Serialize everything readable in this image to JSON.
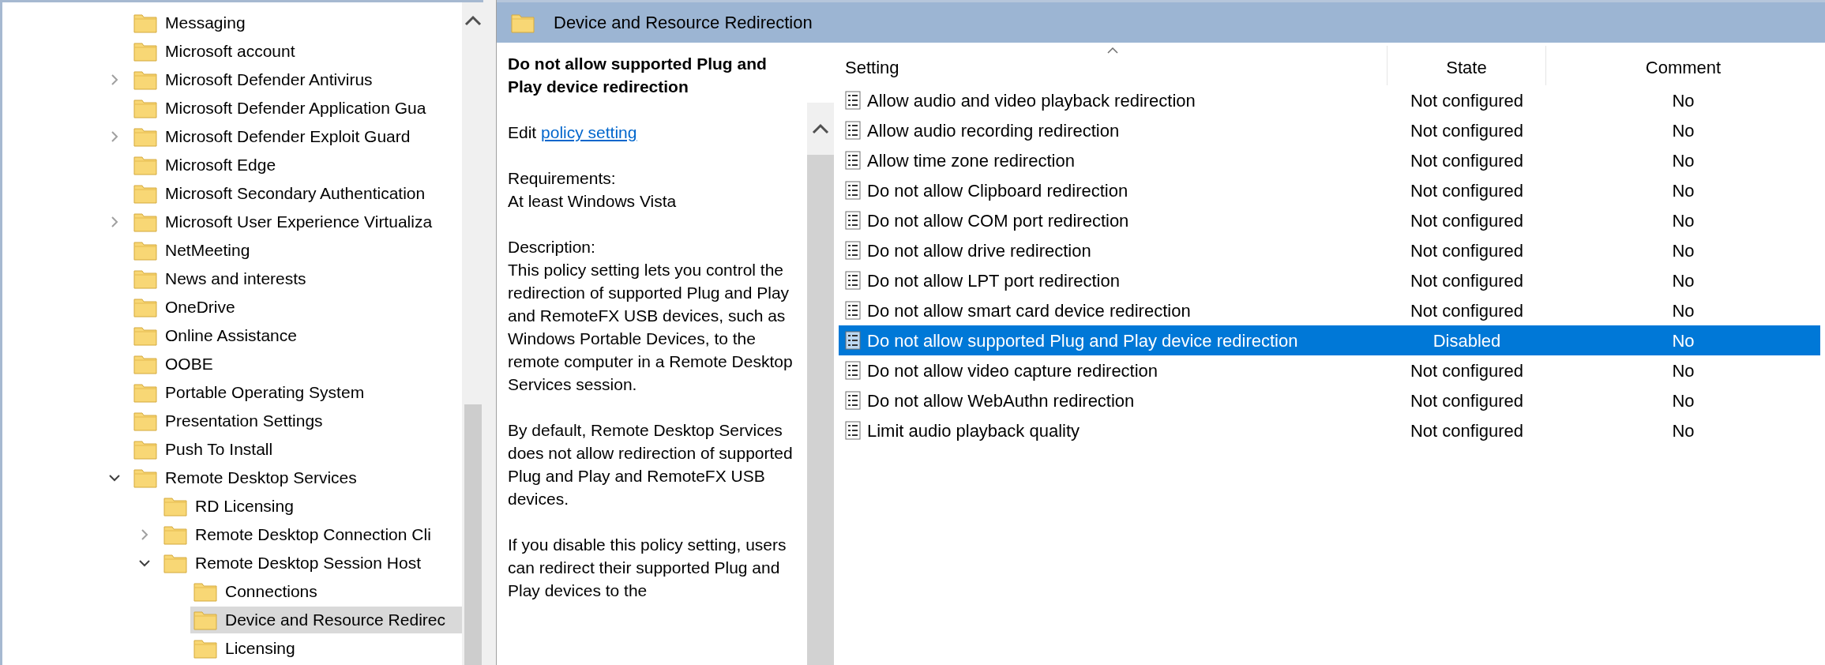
{
  "tree": {
    "items": [
      {
        "label": "Messaging",
        "selected": false
      },
      {
        "label": "Microsoft account",
        "selected": false
      },
      {
        "label": "Microsoft Defender Antivirus",
        "selected": false,
        "expanded": false
      },
      {
        "label": "Microsoft Defender Application Gua",
        "selected": false
      },
      {
        "label": "Microsoft Defender Exploit Guard",
        "selected": false,
        "expanded": false
      },
      {
        "label": "Microsoft Edge",
        "selected": false
      },
      {
        "label": "Microsoft Secondary Authentication",
        "selected": false
      },
      {
        "label": "Microsoft User Experience Virtualiza",
        "selected": false,
        "expanded": false
      },
      {
        "label": "NetMeeting",
        "selected": false
      },
      {
        "label": "News and interests",
        "selected": false
      },
      {
        "label": "OneDrive",
        "selected": false
      },
      {
        "label": "Online Assistance",
        "selected": false
      },
      {
        "label": "OOBE",
        "selected": false
      },
      {
        "label": "Portable Operating System",
        "selected": false
      },
      {
        "label": "Presentation Settings",
        "selected": false
      },
      {
        "label": "Push To Install",
        "selected": false
      },
      {
        "label": "Remote Desktop Services",
        "selected": false,
        "expanded": true,
        "children": [
          {
            "label": "RD Licensing",
            "selected": false
          },
          {
            "label": "Remote Desktop Connection Cli",
            "selected": false,
            "expanded": false
          },
          {
            "label": "Remote Desktop Session Host",
            "selected": false,
            "expanded": true,
            "children": [
              {
                "label": "Connections",
                "selected": false
              },
              {
                "label": "Device and Resource Redirec",
                "selected": true
              },
              {
                "label": "Licensing",
                "selected": false
              }
            ]
          }
        ]
      }
    ]
  },
  "details": {
    "header": "Device and Resource Redirection",
    "policy_title": "Do not allow supported Plug and Play device redirection",
    "edit_prefix": "Edit",
    "edit_link": "policy setting",
    "requirements_label": "Requirements:",
    "requirements": "At least Windows Vista",
    "description_label": "Description:",
    "paragraphs": [
      "This policy setting lets you control the redirection of supported Plug and Play and RemoteFX USB devices, such as Windows Portable Devices, to the remote computer in a Remote Desktop Services session.",
      "By default, Remote Desktop Services does not allow redirection of supported Plug and Play and RemoteFX USB devices.",
      "If you disable this policy setting, users can redirect their supported Plug and Play devices to the"
    ]
  },
  "settings": {
    "columns": [
      {
        "label": "Setting",
        "sorted": true
      },
      {
        "label": "State",
        "sorted": false
      },
      {
        "label": "Comment",
        "sorted": false
      }
    ],
    "rows": [
      {
        "name": "Allow audio and video playback redirection",
        "state": "Not configured",
        "comment": "No",
        "selected": false
      },
      {
        "name": "Allow audio recording redirection",
        "state": "Not configured",
        "comment": "No",
        "selected": false
      },
      {
        "name": "Allow time zone redirection",
        "state": "Not configured",
        "comment": "No",
        "selected": false
      },
      {
        "name": "Do not allow Clipboard redirection",
        "state": "Not configured",
        "comment": "No",
        "selected": false
      },
      {
        "name": "Do not allow COM port redirection",
        "state": "Not configured",
        "comment": "No",
        "selected": false
      },
      {
        "name": "Do not allow drive redirection",
        "state": "Not configured",
        "comment": "No",
        "selected": false
      },
      {
        "name": "Do not allow LPT port redirection",
        "state": "Not configured",
        "comment": "No",
        "selected": false
      },
      {
        "name": "Do not allow smart card device redirection",
        "state": "Not configured",
        "comment": "No",
        "selected": false
      },
      {
        "name": "Do not allow supported Plug and Play device redirection",
        "state": "Disabled",
        "comment": "No",
        "selected": true
      },
      {
        "name": "Do not allow video capture redirection",
        "state": "Not configured",
        "comment": "No",
        "selected": false
      },
      {
        "name": "Do not allow WebAuthn redirection",
        "state": "Not configured",
        "comment": "No",
        "selected": false
      },
      {
        "name": "Limit audio playback quality",
        "state": "Not configured",
        "comment": "No",
        "selected": false
      }
    ]
  }
}
